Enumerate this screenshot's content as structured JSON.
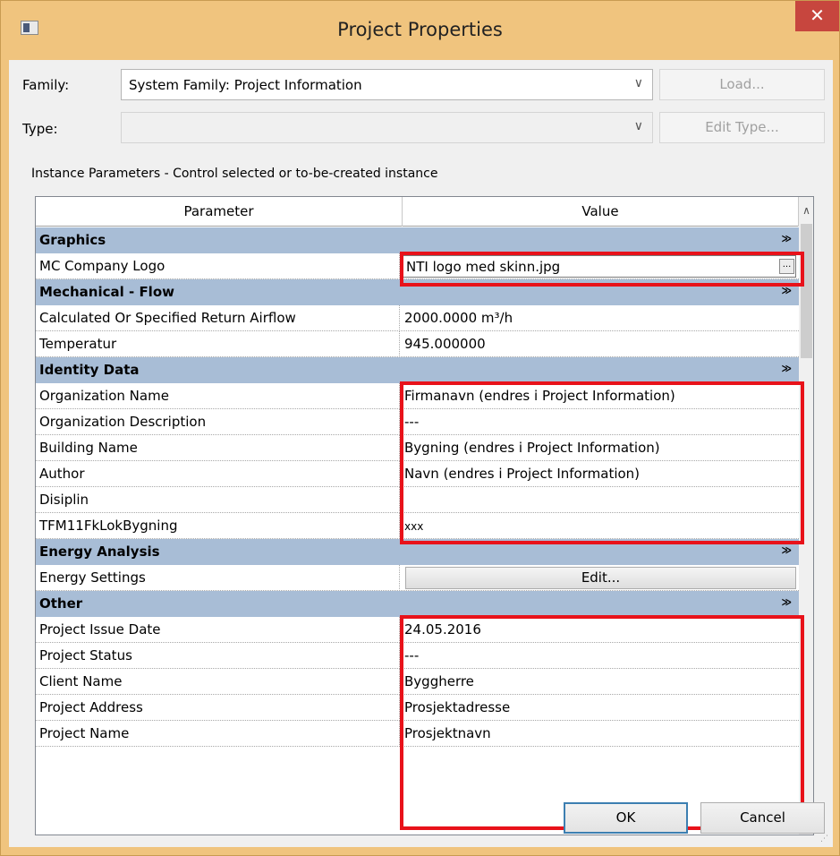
{
  "window": {
    "title": "Project Properties",
    "close_glyph": "✕"
  },
  "form": {
    "family_label": "Family:",
    "family_value": "System Family: Project Information",
    "type_label": "Type:",
    "type_value": "",
    "load_button": "Load...",
    "edit_type_button": "Edit Type..."
  },
  "instance_label": "Instance Parameters - Control selected or to-be-created instance",
  "grid": {
    "headers": [
      "Parameter",
      "Value"
    ],
    "groups": [
      {
        "name": "Graphics"
      },
      {
        "name": "Mechanical - Flow"
      },
      {
        "name": "Identity Data"
      },
      {
        "name": "Energy Analysis"
      },
      {
        "name": "Other"
      }
    ],
    "params": [
      {
        "name": "MC Company Logo",
        "value": "NTI logo med skinn.jpg"
      },
      {
        "name": "Calculated Or Specified Return Airflow",
        "value": "2000.0000 m³/h"
      },
      {
        "name": "Temperatur",
        "value": "945.000000"
      },
      {
        "name": "Organization Name",
        "value": "Firmanavn (endres i Project Information)"
      },
      {
        "name": "Organization Description",
        "value": "---"
      },
      {
        "name": "Building Name",
        "value": "Bygning (endres i Project Information)"
      },
      {
        "name": "Author",
        "value": "Navn (endres i Project Information)"
      },
      {
        "name": "Disiplin",
        "value": ""
      },
      {
        "name": "TFM11FkLokBygning",
        "value": "xxx"
      },
      {
        "name": "Energy Settings",
        "value": "Edit..."
      },
      {
        "name": "Project Issue Date",
        "value": "24.05.2016"
      },
      {
        "name": "Project Status",
        "value": "---"
      },
      {
        "name": "Client Name",
        "value": "Byggherre"
      },
      {
        "name": "Project Address",
        "value": "Prosjektadresse"
      },
      {
        "name": "Project Name",
        "value": "Prosjektnavn"
      }
    ],
    "collapse_glyph": "≫",
    "browse_glyph": "..."
  },
  "buttons": {
    "ok": "OK",
    "cancel": "Cancel"
  },
  "colors": {
    "title_bar": "#f0c47e",
    "group_row": "#a8bdd6",
    "highlight_box": "#e8121a",
    "close_button": "#c7463e"
  }
}
